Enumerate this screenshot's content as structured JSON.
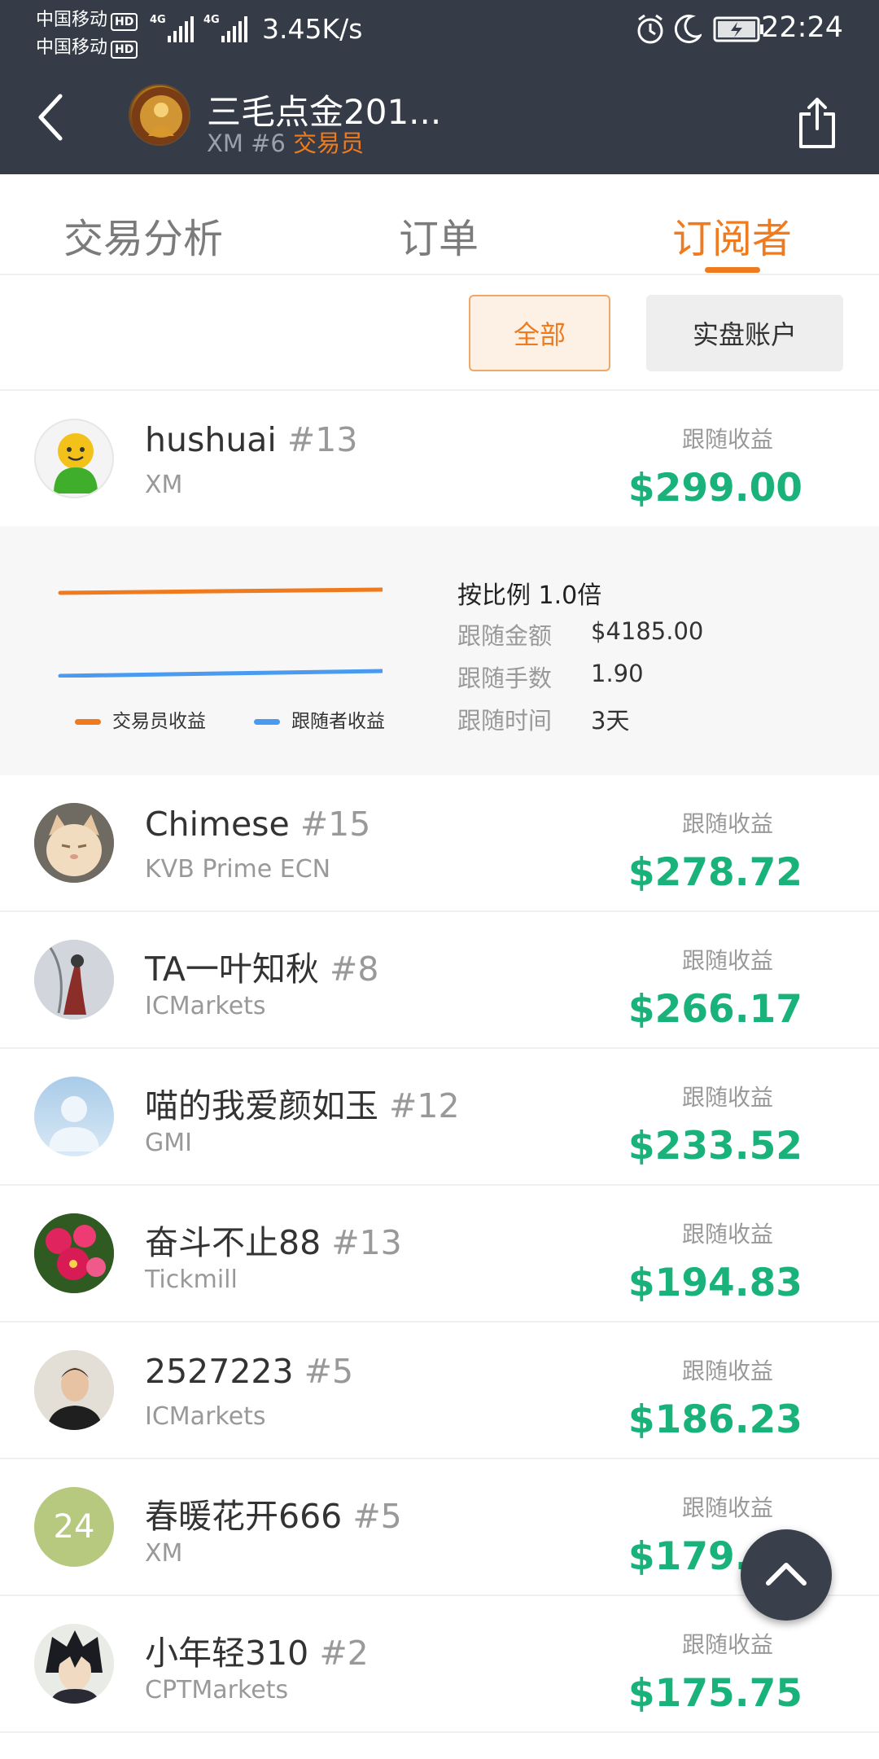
{
  "status_bar": {
    "carrier1": "中国移动",
    "carrier2": "中国移动",
    "hd": "HD",
    "net_speed": "3.45K/s",
    "time": "22:24"
  },
  "header": {
    "trader_name": "三毛点金201...",
    "broker_rank": "XM #6",
    "role": "交易员"
  },
  "tabs": [
    {
      "label": "交易分析",
      "active": false
    },
    {
      "label": "订单",
      "active": false
    },
    {
      "label": "订阅者",
      "active": true
    }
  ],
  "filters": {
    "all_label": "全部",
    "real_label": "实盘账户",
    "selected": "全部"
  },
  "profit_label": "跟随收益",
  "subscribers": [
    {
      "name": "hushuai",
      "rank": "#13",
      "broker": "XM",
      "profit": "$299.00",
      "avatar": "green-smiley-avatar"
    },
    {
      "name": "Chimese",
      "rank": "#15",
      "broker": "KVB Prime ECN",
      "profit": "$278.72",
      "avatar": "cat-avatar"
    },
    {
      "name": "TA一叶知秋",
      "rank": "#8",
      "broker": "ICMarkets",
      "profit": "$266.17",
      "avatar": "figure-avatar"
    },
    {
      "name": "喵的我爱颜如玉",
      "rank": "#12",
      "broker": "GMI",
      "profit": "$233.52",
      "avatar": "default-person-avatar"
    },
    {
      "name": "奋斗不止88",
      "rank": "#13",
      "broker": "Tickmill",
      "profit": "$194.83",
      "avatar": "flower-avatar"
    },
    {
      "name": "2527223",
      "rank": "#5",
      "broker": "ICMarkets",
      "profit": "$186.23",
      "avatar": "man-photo-avatar"
    },
    {
      "name": "春暖花开666",
      "rank": "#5",
      "broker": "XM",
      "profit": "$179.46",
      "avatar": "number-avatar",
      "avatar_text": "24"
    },
    {
      "name": "小年轻310",
      "rank": "#2",
      "broker": "CPTMarkets",
      "profit": "$175.75",
      "avatar": "anime-avatar"
    }
  ],
  "detail": {
    "ratio": "按比例 1.0倍",
    "amount_label": "跟随金额",
    "amount": "$4185.00",
    "lots_label": "跟随手数",
    "lots": "1.90",
    "time_label": "跟随时间",
    "time": "3天",
    "legend_trader": "交易员收益",
    "legend_follower": "跟随者收益",
    "colors": {
      "trader": "#f07a1e",
      "follower": "#4a9bef"
    }
  },
  "colors": {
    "accent": "#f07a1e",
    "profit": "#19b27b",
    "header_bg": "#353c47"
  }
}
